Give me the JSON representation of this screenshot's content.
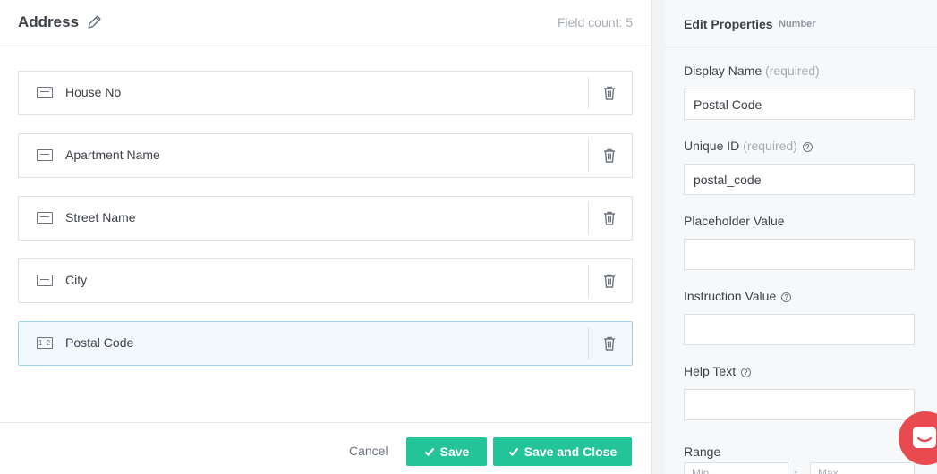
{
  "form": {
    "title": "Address",
    "field_count": "Field count: 5",
    "fields": [
      {
        "label": "House No",
        "type": "text"
      },
      {
        "label": "Apartment Name",
        "type": "text"
      },
      {
        "label": "Street Name",
        "type": "text"
      },
      {
        "label": "City",
        "type": "text"
      },
      {
        "label": "Postal Code",
        "type": "number",
        "selected": true
      }
    ],
    "number_glyph": "1 2"
  },
  "footer": {
    "cancel_label": "Cancel",
    "save_label": "Save",
    "save_close_label": "Save and Close"
  },
  "properties": {
    "title": "Edit Properties",
    "field_type": "Number",
    "display_name_label": "Display Name",
    "required_tag": "(required)",
    "display_name_value": "Postal Code",
    "unique_id_label": "Unique ID",
    "unique_id_value": "postal_code",
    "placeholder_label": "Placeholder Value",
    "placeholder_value": "",
    "instruction_label": "Instruction Value",
    "instruction_value": "",
    "help_text_label": "Help Text",
    "help_text_value": "",
    "range_label": "Range",
    "range_min_placeholder": "Min",
    "range_max_placeholder": "Max",
    "range_separator": "-",
    "help_glyph": "?"
  },
  "colors": {
    "accent_green": "#23c49a",
    "selected_bg": "#f2f9fc",
    "chat_red": "#e84a4f"
  },
  "icons": [
    "edit-pencil-icon",
    "text-field-icon",
    "number-field-icon",
    "trash-icon",
    "check-icon",
    "help-circle-icon",
    "chat-icon"
  ]
}
